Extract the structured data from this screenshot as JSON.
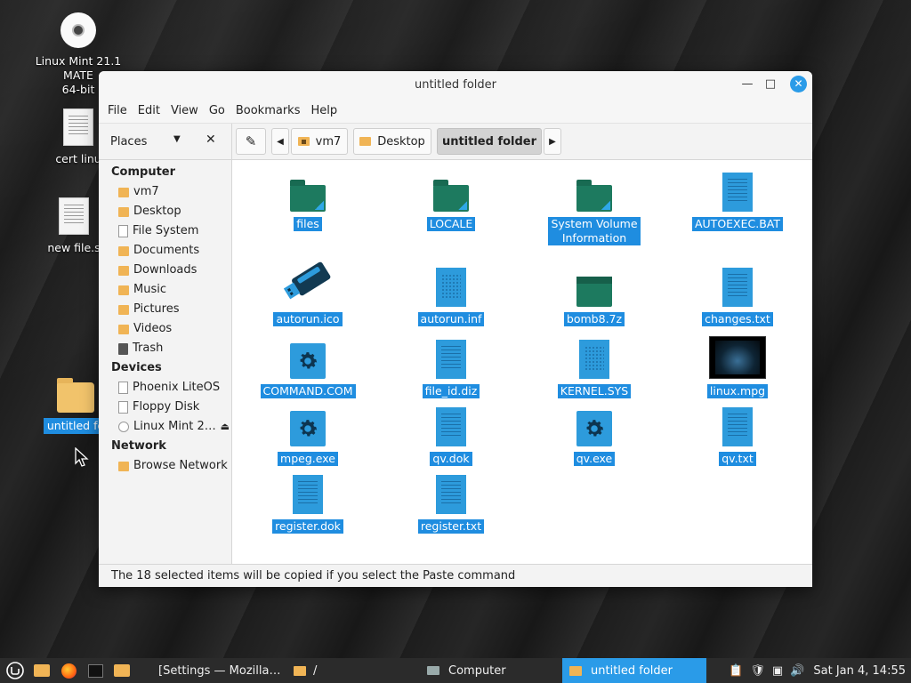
{
  "desktop": {
    "icons": [
      {
        "label": "Linux Mint 21.1 MATE\n64-bit",
        "icon": "disc-icon"
      },
      {
        "label": "cert linu",
        "icon": "document-icon"
      },
      {
        "label": "new file.s",
        "icon": "document-icon"
      },
      {
        "label": "untitled fo",
        "icon": "folder-icon"
      }
    ]
  },
  "window": {
    "title": "untitled folder",
    "controls": {
      "minimize": "—",
      "maximize": "□",
      "close": "✕"
    },
    "menu": [
      "File",
      "Edit",
      "View",
      "Go",
      "Bookmarks",
      "Help"
    ],
    "places_label": "Places",
    "places_dropdown_icon": "▼",
    "places_close_icon": "✕",
    "edit_icon": "✎",
    "path_back_icon": "◀",
    "path_forward_icon": "▶",
    "path": [
      "vm7",
      "Desktop",
      "untitled folder"
    ],
    "sidebar": {
      "computer": {
        "header": "Computer",
        "items": [
          "vm7",
          "Desktop",
          "File System",
          "Documents",
          "Downloads",
          "Music",
          "Pictures",
          "Videos",
          "Trash"
        ]
      },
      "devices": {
        "header": "Devices",
        "items": [
          "Phoenix LiteOS",
          "Floppy Disk",
          "Linux Mint 2…"
        ],
        "eject_icon": "⏏"
      },
      "network": {
        "header": "Network",
        "items": [
          "Browse Network"
        ]
      }
    },
    "files": [
      {
        "name": "files",
        "icon": "folder"
      },
      {
        "name": "LOCALE",
        "icon": "folder"
      },
      {
        "name": "System Volume\nInformation",
        "icon": "folder"
      },
      {
        "name": "AUTOEXEC.BAT",
        "icon": "document"
      },
      {
        "name": "autorun.ico",
        "icon": "usb"
      },
      {
        "name": "autorun.inf",
        "icon": "document-dots"
      },
      {
        "name": "bomb8.7z",
        "icon": "archive"
      },
      {
        "name": "changes.txt",
        "icon": "document"
      },
      {
        "name": "COMMAND.COM",
        "icon": "gear"
      },
      {
        "name": "file_id.diz",
        "icon": "document"
      },
      {
        "name": "KERNEL.SYS",
        "icon": "document-dots"
      },
      {
        "name": "linux.mpg",
        "icon": "video"
      },
      {
        "name": "mpeg.exe",
        "icon": "gear"
      },
      {
        "name": "qv.dok",
        "icon": "document"
      },
      {
        "name": "qv.exe",
        "icon": "gear"
      },
      {
        "name": "qv.txt",
        "icon": "document"
      },
      {
        "name": "register.dok",
        "icon": "document"
      },
      {
        "name": "register.txt",
        "icon": "document"
      }
    ],
    "status": "The 18 selected items will be copied if you select the Paste command"
  },
  "taskbar": {
    "tasks": [
      "[Settings — Mozilla…",
      "/",
      "Computer",
      "untitled folder"
    ],
    "clock": "Sat Jan  4, 14:55"
  },
  "colors": {
    "selection": "#1f8de0",
    "folder_icon": "#1d7a5f",
    "document_icon": "#2d9bdc",
    "taskbar_active": "#2a9be8"
  }
}
